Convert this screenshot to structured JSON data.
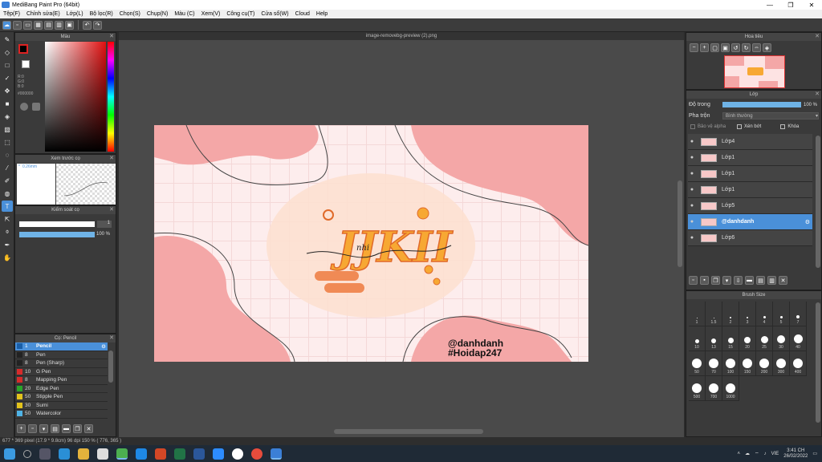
{
  "window": {
    "title": "MediBang Paint Pro (64bit)",
    "min": "—",
    "max": "❐",
    "close": "✕"
  },
  "menu": [
    "Tệp(F)",
    "Chỉnh sửa(E)",
    "Lớp(L)",
    "Bộ lọc(R)",
    "Chọn(S)",
    "Chụp(N)",
    "Màu (C)",
    "Xem(V)",
    "Công cụ(T)",
    "Cửa sổ(W)",
    "Cloud",
    "Help"
  ],
  "document": {
    "tab": "image-removebg-preview (2).png",
    "signature": "nhi",
    "handle": "@danhdanh",
    "hashtag": "#Hoidap247"
  },
  "color_panel": {
    "title": "Màu",
    "r": "R:0",
    "g": "G:0",
    "b": "B:0",
    "hex": "#000000"
  },
  "brush_preview": {
    "title": "Xem trước cọ",
    "size": "0.26mm"
  },
  "brush_control": {
    "title": "Kiểm soát cọ",
    "size_value": "1",
    "opacity": "100 %"
  },
  "brush_list": {
    "title": "Cọ: Pencil",
    "items": [
      {
        "size": "1",
        "name": "Pencil",
        "color": "#1a5fa8"
      },
      {
        "size": "8",
        "name": "Pen",
        "color": "#222222"
      },
      {
        "size": "8",
        "name": "Pen (Sharp)",
        "color": "#222222"
      },
      {
        "size": "10",
        "name": "G Pen",
        "color": "#d62b2b"
      },
      {
        "size": "8",
        "name": "Mapping Pen",
        "color": "#d62b2b"
      },
      {
        "size": "20",
        "name": "Edge Pen",
        "color": "#2aa52a"
      },
      {
        "size": "50",
        "name": "Stipple Pen",
        "color": "#e3c31c"
      },
      {
        "size": "30",
        "name": "Sumi",
        "color": "#e3c31c"
      },
      {
        "size": "50",
        "name": "Watercolor",
        "color": "#4fb3e6"
      }
    ]
  },
  "navigator": {
    "title": "Hoa tiêu"
  },
  "layer_panel": {
    "title": "Lớp",
    "opacity_label": "Độ trong",
    "opacity_value": "100 %",
    "blend_label": "Pha trộn",
    "blend_value": "Bình thường",
    "protect_alpha": "Bảo vệ alpha",
    "clipping": "Xén bớt",
    "lock": "Khóa",
    "layers": [
      "Lớp4",
      "Lớp1",
      "Lớp1",
      "Lớp1",
      "Lớp5",
      "@danhdanh",
      "Lớp6"
    ]
  },
  "brush_size": {
    "title": "Brush Size",
    "sizes": [
      "1",
      "1.5",
      "2",
      "3",
      "4",
      "5",
      "7",
      "10",
      "13",
      "15",
      "20",
      "25",
      "30",
      "40",
      "50",
      "70",
      "100",
      "150",
      "200",
      "300",
      "400",
      "500",
      "700",
      "1000"
    ]
  },
  "status": "677 * 369 pixel   (17.9 * 9.8cm)   96 dpi   150 %   ( 776, 365 )",
  "clock": {
    "time": "3:41 CH",
    "date": "26/02/2022",
    "lang": "VIE"
  },
  "colors": {
    "accent": "#4a90d9",
    "pink": "#f4a7a7",
    "canvas_bg": "#fbe9e9"
  }
}
